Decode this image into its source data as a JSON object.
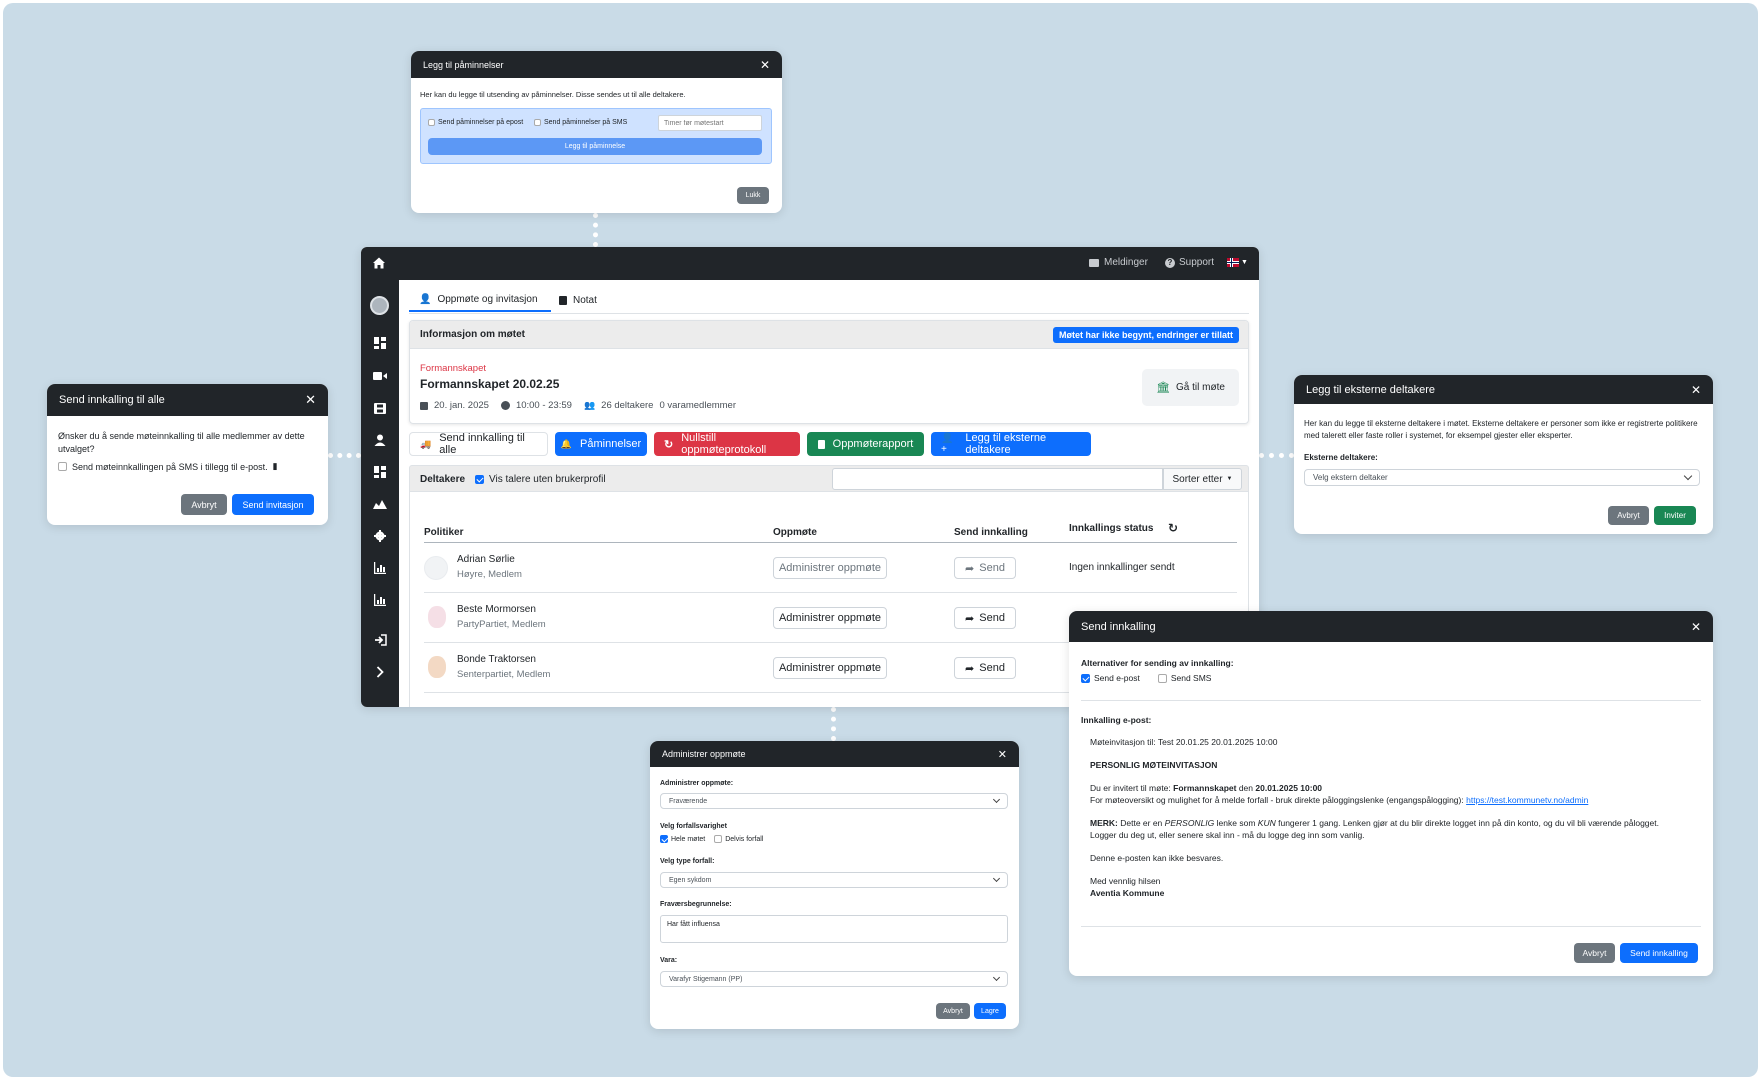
{
  "reminders_modal": {
    "title": "Legg til påminnelser",
    "description": "Her kan du legge til utsending av påminnelser. Disse sendes ut til alle deltakere.",
    "email_option": "Send påminnelser på epost",
    "sms_option": "Send påminnelser på SMS",
    "hours_placeholder": "Timer før møtestart",
    "add_button": "Legg til påminnelse",
    "close_button": "Lukk"
  },
  "send_all_modal": {
    "title": "Send innkalling til alle",
    "question": "Ønsker du å sende møteinnkalling til alle medlemmer av dette utvalget?",
    "sms_option": "Send møteinnkallingen på SMS i tillegg til e-post.",
    "cancel": "Avbryt",
    "confirm": "Send invitasjon"
  },
  "external_modal": {
    "title": "Legg til eksterne deltakere",
    "description": "Her kan du legge til eksterne deltakere i møtet. Eksterne deltakere er personer som ikke er registrerte politikere med talerett eller faste roller i systemet, for eksempel gjester eller eksperter.",
    "label": "Eksterne deltakere:",
    "select_value": "Velg ekstern deltaker",
    "cancel": "Avbryt",
    "confirm": "Inviter"
  },
  "app": {
    "topbar": {
      "messages": "Meldinger",
      "support": "Support"
    },
    "tabs": [
      "Oppmøte og invitasjon",
      "Notat"
    ],
    "info": {
      "header": "Informasjon om møtet",
      "status_badge": "Møtet har ikke begynt, endringer er tillatt",
      "committee": "Formannskapet",
      "meeting_title": "Formannskapet 20.02.25",
      "date": "20. jan. 2025",
      "time": "10:00 - 23:59",
      "participants": "26 deltakere",
      "substitutes": "0 varamedlemmer",
      "go_button": "Gå til møte"
    },
    "actions": {
      "send_all": "Send innkalling til alle",
      "reminders": "Påminnelser",
      "reset": "Nullstill oppmøteprotokoll",
      "report": "Oppmøterapport",
      "external": "Legg til eksterne deltakere"
    },
    "participants_bar": {
      "label": "Deltakere",
      "show_speakers": "Vis talere uten brukerprofil",
      "sort": "Sorter etter"
    },
    "table": {
      "headers": [
        "Politiker",
        "Oppmøte",
        "Send innkalling",
        "Innkallings status"
      ],
      "rows": [
        {
          "name": "Adrian Sørlie",
          "party": "Høyre, Medlem",
          "manage": "Administrer oppmøte",
          "send": "Send",
          "status": "Ingen innkallinger sendt"
        },
        {
          "name": "Beste Mormorsen",
          "party": "PartyPartiet, Medlem",
          "manage": "Administrer oppmøte",
          "send": "Send",
          "status": ""
        },
        {
          "name": "Bonde Traktorsen",
          "party": "Senterpartiet, Medlem",
          "manage": "Administrer oppmøte",
          "send": "Send",
          "status": ""
        }
      ]
    }
  },
  "send_invite_modal": {
    "title": "Send innkalling",
    "options_label": "Alternativer for sending av innkalling:",
    "email_option": "Send e-post",
    "sms_option": "Send SMS",
    "email_label": "Innkalling e-post:",
    "subject": "Møteinvitasjon til: Test 20.01.25 20.01.2025 10:00",
    "heading": "PERSONLIG MØTEINVITASJON",
    "line1_prefix": "Du er invitert til møte:",
    "line1_meeting": "Formannskapet",
    "line1_mid": "den",
    "line1_date": "20.01.2025 10:00",
    "line2": "For møteoversikt og mulighet for å melde forfall - bruk direkte påloggingslenke (engangspålogging):",
    "link": "https://test.kommunetv.no/admin",
    "note_label": "MERK:",
    "note_a": "Dette er en",
    "note_personal": "PERSONLIG",
    "note_b": "lenke som",
    "note_only": "KUN",
    "note_c": "fungerer 1 gang. Lenken gjør at du blir direkte logget inn på din konto, og du vil bli værende pålogget.",
    "note2": "Logger du deg ut, eller senere skal inn - må du logge deg inn som vanlig.",
    "no_reply": "Denne e-posten kan ikke besvares.",
    "greeting": "Med vennlig hilsen",
    "sender": "Aventia Kommune",
    "cancel": "Avbryt",
    "confirm": "Send innkalling"
  },
  "attendance_modal": {
    "title": "Administrer oppmøte",
    "manage_label": "Administrer oppmøte:",
    "manage_value": "Fraværende",
    "duration_label": "Velg forfallsvarighet",
    "whole": "Hele møtet",
    "partial": "Delvis forfall",
    "type_label": "Velg type forfall:",
    "type_value": "Egen sykdom",
    "reason_label": "Fraværsbegrunnelse:",
    "reason_value": "Har fått influensa",
    "vara_label": "Vara:",
    "vara_value": "Varafyr Stigemann (PP)",
    "cancel": "Avbryt",
    "save": "Lagre"
  }
}
